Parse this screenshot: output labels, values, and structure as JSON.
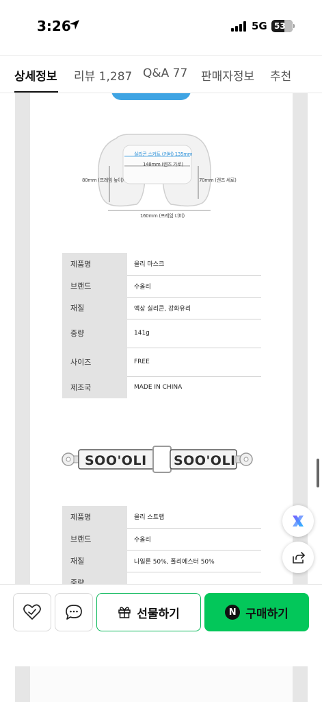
{
  "status_bar": {
    "time": "3:26",
    "network": "5G",
    "battery": "53"
  },
  "tabs": [
    {
      "label": "상세정보",
      "active": true
    },
    {
      "label": "리뷰 1,287",
      "active": false
    },
    {
      "label": "Q&A 77",
      "active": false
    },
    {
      "label": "판매자정보",
      "active": false
    },
    {
      "label": "추천",
      "active": false
    }
  ],
  "mask_dimensions": {
    "silicone_skirt": "실리콘 스커트 (커버) 135mm",
    "lens_width": "148mm (렌즈 가로)",
    "frame_height": "80mm (프레임 높이)",
    "lens_height": "70mm (렌즈 세로)",
    "frame_width": "160mm (프레임 너비)"
  },
  "spec_table_1": [
    {
      "key": "제품명",
      "value": "올리 마스크"
    },
    {
      "key": "브랜드",
      "value": "수올리"
    },
    {
      "key": "재질",
      "value": "액상 실리콘, 강화유리"
    },
    {
      "key": "중량",
      "value": "141g"
    },
    {
      "key": "사이즈",
      "value": "FREE"
    },
    {
      "key": "제조국",
      "value": "MADE IN CHINA"
    }
  ],
  "strap_logo": "SOO'OLI",
  "spec_table_2": [
    {
      "key": "제품명",
      "value": "올리 스트랩"
    },
    {
      "key": "브랜드",
      "value": "수올리"
    },
    {
      "key": "재질",
      "value": "나일론 50%, 폴리에스터 50%"
    },
    {
      "key": "중량",
      "value": ""
    }
  ],
  "bottom_bar": {
    "gift_label": "선물하기",
    "buy_label": "구매하기",
    "buy_badge": "N"
  },
  "colors": {
    "accent_green": "#03c75a",
    "gift_border": "#0ab85a",
    "blue_pill": "#3fa4e3"
  }
}
